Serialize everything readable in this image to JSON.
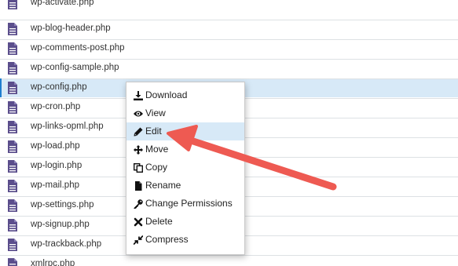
{
  "files": [
    {
      "name": "wp-activate.php",
      "selected": false
    },
    {
      "name": "wp-blog-header.php",
      "selected": false
    },
    {
      "name": "wp-comments-post.php",
      "selected": false
    },
    {
      "name": "wp-config-sample.php",
      "selected": false
    },
    {
      "name": "wp-config.php",
      "selected": true
    },
    {
      "name": "wp-cron.php",
      "selected": false
    },
    {
      "name": "wp-links-opml.php",
      "selected": false
    },
    {
      "name": "wp-load.php",
      "selected": false
    },
    {
      "name": "wp-login.php",
      "selected": false
    },
    {
      "name": "wp-mail.php",
      "selected": false
    },
    {
      "name": "wp-settings.php",
      "selected": false
    },
    {
      "name": "wp-signup.php",
      "selected": false
    },
    {
      "name": "wp-trackback.php",
      "selected": false
    },
    {
      "name": "xmlrpc.php",
      "selected": false
    }
  ],
  "file_icon": "document-icon",
  "context_menu": {
    "items": [
      {
        "label": "Download",
        "icon": "download-icon",
        "highlighted": false
      },
      {
        "label": "View",
        "icon": "eye-icon",
        "highlighted": false
      },
      {
        "label": "Edit",
        "icon": "pencil-icon",
        "highlighted": true
      },
      {
        "label": "Move",
        "icon": "move-arrows-icon",
        "highlighted": false
      },
      {
        "label": "Copy",
        "icon": "copy-icon",
        "highlighted": false
      },
      {
        "label": "Rename",
        "icon": "file-icon",
        "highlighted": false
      },
      {
        "label": "Change Permissions",
        "icon": "key-icon",
        "highlighted": false
      },
      {
        "label": "Delete",
        "icon": "x-icon",
        "highlighted": false
      },
      {
        "label": "Compress",
        "icon": "compress-icon",
        "highlighted": false
      }
    ]
  },
  "colors": {
    "selected_row": "#d7e9f7",
    "file_icon": "#5b4e8c",
    "annotation_arrow": "#ee5a52"
  }
}
